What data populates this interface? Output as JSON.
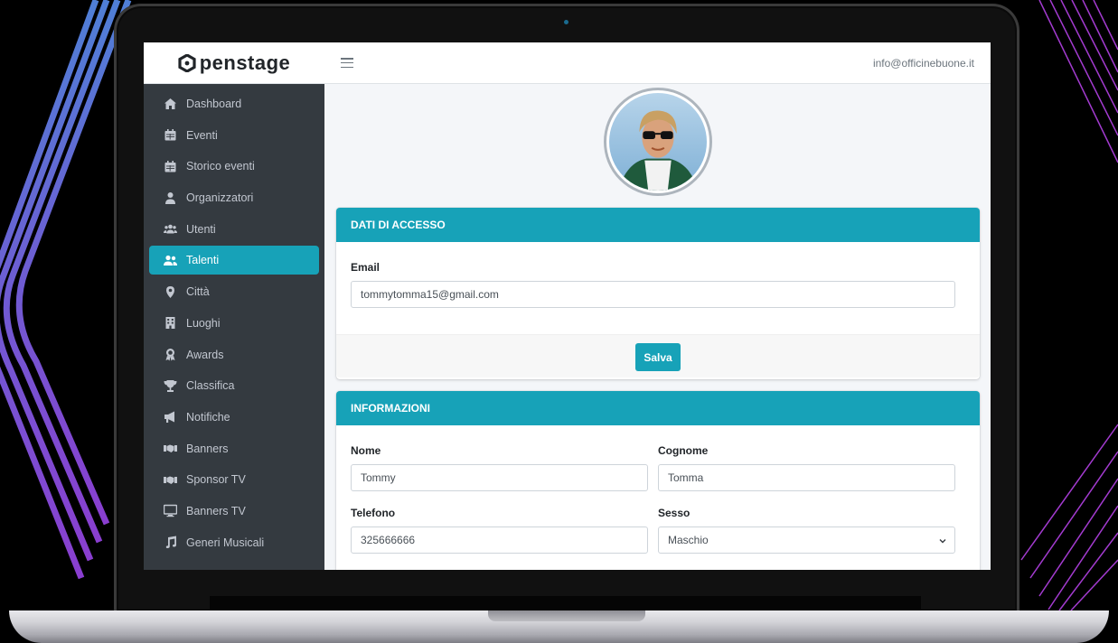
{
  "app": {
    "brand": "penstage",
    "user_email": "info@officinebuone.it"
  },
  "colors": {
    "accent": "#17a2b8",
    "sidebar_bg": "#343a40",
    "sidebar_text": "#c2c7d0"
  },
  "sidebar": {
    "items": [
      {
        "label": "Dashboard",
        "icon": "home-icon"
      },
      {
        "label": "Eventi",
        "icon": "calendar-icon"
      },
      {
        "label": "Storico eventi",
        "icon": "calendar-icon"
      },
      {
        "label": "Organizzatori",
        "icon": "user-tie-icon"
      },
      {
        "label": "Utenti",
        "icon": "users-icon"
      },
      {
        "label": "Talenti",
        "icon": "user-friends-icon",
        "active": true
      },
      {
        "label": "Città",
        "icon": "map-marker-icon"
      },
      {
        "label": "Luoghi",
        "icon": "building-icon"
      },
      {
        "label": "Awards",
        "icon": "award-icon"
      },
      {
        "label": "Classifica",
        "icon": "trophy-icon"
      },
      {
        "label": "Notifiche",
        "icon": "megaphone-icon"
      },
      {
        "label": "Banners",
        "icon": "handshake-icon"
      },
      {
        "label": "Sponsor TV",
        "icon": "handshake-icon"
      },
      {
        "label": "Banners TV",
        "icon": "desktop-icon"
      },
      {
        "label": "Generi Musicali",
        "icon": "music-icon"
      }
    ]
  },
  "access_card": {
    "title": "DATI DI ACCESSO",
    "email_label": "Email",
    "email_value": "tommytomma15@gmail.com",
    "save_label": "Salva"
  },
  "info_card": {
    "title": "INFORMAZIONI",
    "nome_label": "Nome",
    "nome_value": "Tommy",
    "cognome_label": "Cognome",
    "cognome_value": "Tomma",
    "telefono_label": "Telefono",
    "telefono_value": "325666666",
    "sesso_label": "Sesso",
    "sesso_value": "Maschio"
  }
}
